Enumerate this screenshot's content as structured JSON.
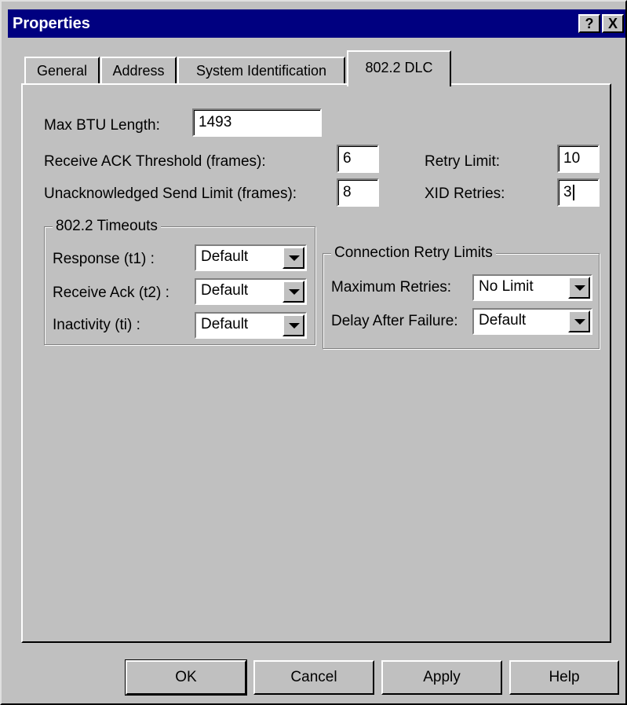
{
  "window": {
    "title": "Properties",
    "help_button": "?",
    "close_button": "X"
  },
  "tabs": [
    {
      "label": "General"
    },
    {
      "label": "Address"
    },
    {
      "label": "System Identification"
    },
    {
      "label": "802.2 DLC",
      "active": true
    }
  ],
  "fields": {
    "max_btu_label": "Max BTU Length:",
    "max_btu_value": "1493",
    "receive_ack_label": "Receive ACK Threshold (frames):",
    "receive_ack_value": "6",
    "unack_send_label": "Unacknowledged Send Limit (frames):",
    "unack_send_value": "8",
    "retry_limit_label": "Retry Limit:",
    "retry_limit_value": "10",
    "xid_retries_label": "XID Retries:",
    "xid_retries_value": "3"
  },
  "timeouts": {
    "title": "802.2 Timeouts",
    "response_label": "Response (t1) :",
    "response_value": "Default",
    "receive_ack_label": "Receive Ack (t2) :",
    "receive_ack_value": "Default",
    "inactivity_label": "Inactivity (ti) :",
    "inactivity_value": "Default"
  },
  "connection_retry": {
    "title": "Connection Retry Limits",
    "max_retries_label": "Maximum Retries:",
    "max_retries_value": "No Limit",
    "delay_label": "Delay After Failure:",
    "delay_value": "Default"
  },
  "buttons": {
    "ok": "OK",
    "cancel": "Cancel",
    "apply": "Apply",
    "help": "Help"
  }
}
